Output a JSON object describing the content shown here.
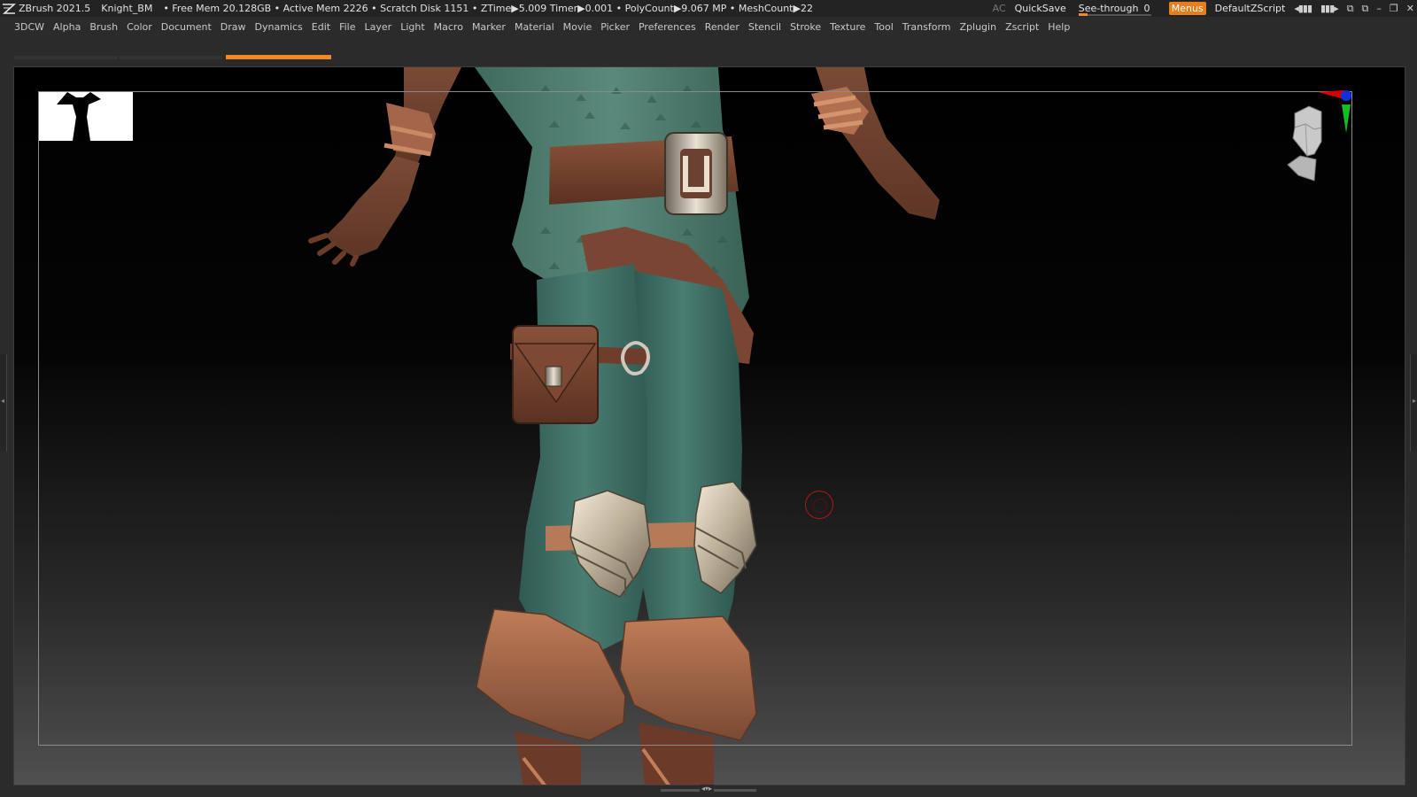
{
  "titlebar": {
    "app": "ZBrush 2021.5",
    "document": "Knight_BM",
    "stats": "• Free Mem 20.128GB • Active Mem 2226 • Scratch Disk 1151 • ZTime▶5.009 Timer▶0.001 • PolyCount▶9.067 MP • MeshCount▶22",
    "ac_label": "AC",
    "quicksave_label": "QuickSave",
    "seethrough_label": "See-through",
    "seethrough_value": "0",
    "menus_label": "Menus",
    "script_label": "DefaultZScript",
    "icons": [
      "layout-prev-icon",
      "layout-next-icon",
      "window-popout-icon",
      "window-dock-icon",
      "minimize-icon",
      "restore-icon",
      "close-icon"
    ]
  },
  "menubar": {
    "items": [
      "3DCW",
      "Alpha",
      "Brush",
      "Color",
      "Document",
      "Draw",
      "Dynamics",
      "Edit",
      "File",
      "Layer",
      "Light",
      "Macro",
      "Marker",
      "Material",
      "Movie",
      "Picker",
      "Preferences",
      "Render",
      "Stencil",
      "Stroke",
      "Texture",
      "Tool",
      "Transform",
      "Zplugin",
      "Zscript",
      "Help"
    ]
  },
  "tabs": {
    "active_index": 2,
    "count": 3
  },
  "colors": {
    "accent": "#f08a24",
    "titlebar_bg": "#232323",
    "ui_bg": "#2b2b2b",
    "cursor_ring": "#b01818"
  },
  "viewport": {
    "icons": [
      "navigation-gizmo-icon",
      "brush-cursor-icon",
      "silhouette-thumbnail"
    ]
  }
}
